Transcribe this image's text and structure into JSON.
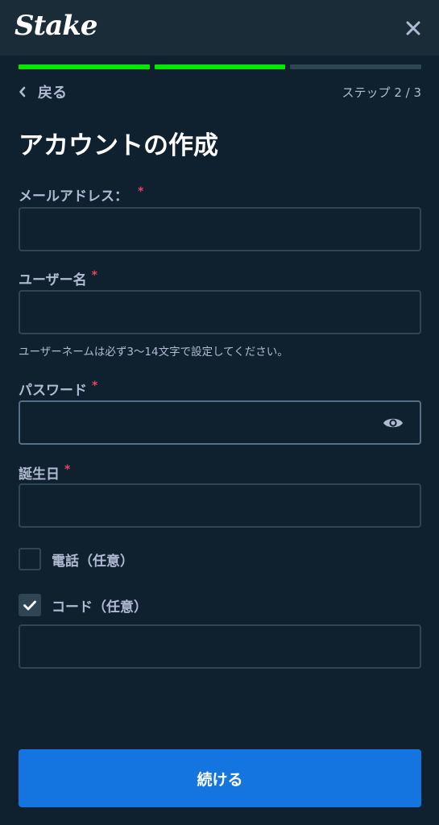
{
  "header": {
    "logo_text": "Stake",
    "close_icon": "close-icon"
  },
  "progress": {
    "total_steps": 3,
    "completed_steps": 2,
    "done_color": "#00e701",
    "pending_color": "#2f4553"
  },
  "nav": {
    "back_label": "戻る",
    "step_text": "ステップ 2 / 3"
  },
  "form": {
    "title": "アカウントの作成",
    "email": {
      "label": "メールアドレス：",
      "required_mark": "*",
      "value": ""
    },
    "username": {
      "label": "ユーザー名",
      "required_mark": "*",
      "value": "",
      "helper": "ユーザーネームは必ず3〜14文字で設定してください。"
    },
    "password": {
      "label": "パスワード",
      "required_mark": "*",
      "value": "",
      "icon": "eye-icon"
    },
    "birthday": {
      "label": "誕生日",
      "required_mark": "*",
      "value": ""
    },
    "phone_option": {
      "label": "電話（任意）",
      "checked": false
    },
    "code_option": {
      "label": "コード（任意）",
      "checked": true,
      "value": ""
    },
    "submit_label": "続ける"
  },
  "colors": {
    "background": "#0f212e",
    "header": "#1a2c38",
    "accent_button": "#1475e1",
    "required": "#ed4163"
  }
}
